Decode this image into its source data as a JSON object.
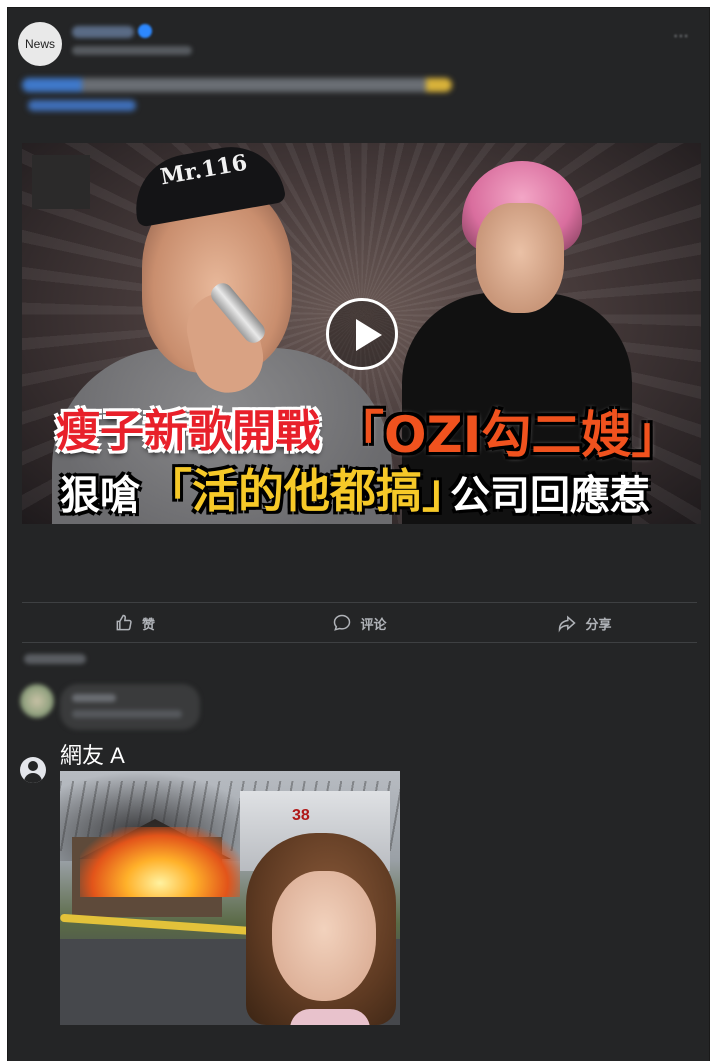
{
  "post": {
    "page_avatar_label": "News",
    "more_icon": "⋯"
  },
  "video": {
    "play_icon": "play-icon",
    "headline_line1_part1": "瘦子新歌開戰",
    "headline_line1_part2": "「OZI勾二嫂」",
    "headline_line2_part1": "狠嗆",
    "headline_line2_part2": "「活的他都搞」",
    "headline_line2_part3": "公司回應惹",
    "cap_text": "Mr.116"
  },
  "actions": [
    {
      "label": "赞",
      "icon": "thumbs-up-icon"
    },
    {
      "label": "评论",
      "icon": "comment-icon"
    },
    {
      "label": "分享",
      "icon": "share-icon"
    }
  ],
  "comment": {
    "user_name": "網友 A",
    "avatar_icon": "default-user-icon",
    "truck_number": "38"
  }
}
